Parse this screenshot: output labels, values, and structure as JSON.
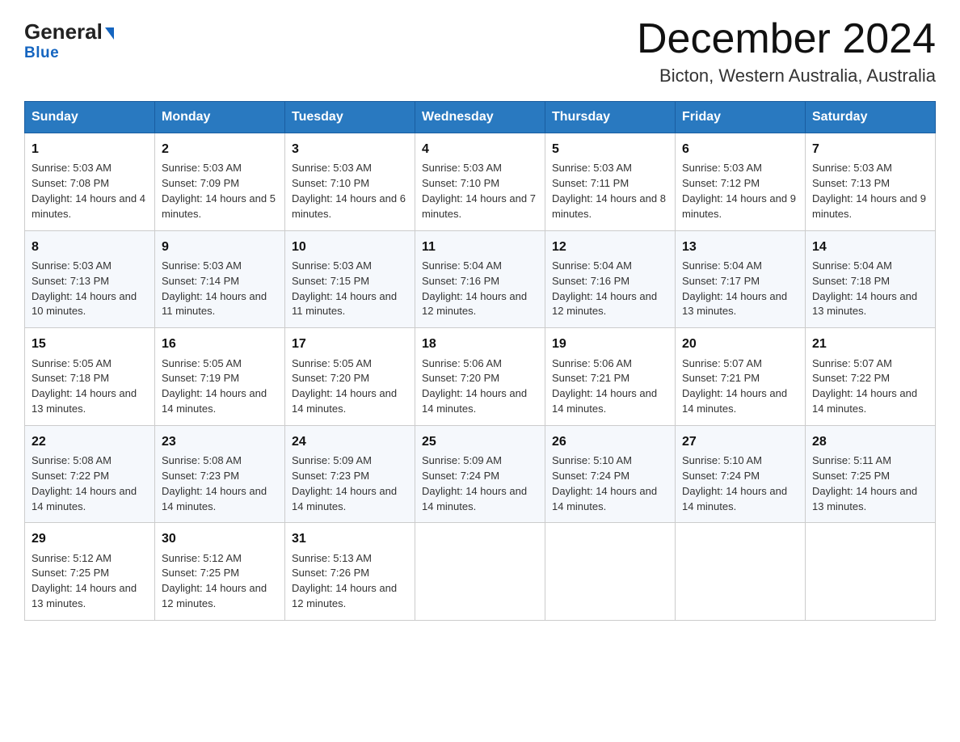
{
  "header": {
    "logo_general": "General",
    "logo_arrow": "▶",
    "logo_blue": "Blue",
    "month_title": "December 2024",
    "location": "Bicton, Western Australia, Australia"
  },
  "weekdays": [
    "Sunday",
    "Monday",
    "Tuesday",
    "Wednesday",
    "Thursday",
    "Friday",
    "Saturday"
  ],
  "weeks": [
    [
      {
        "day": "1",
        "sunrise": "5:03 AM",
        "sunset": "7:08 PM",
        "daylight": "14 hours and 4 minutes."
      },
      {
        "day": "2",
        "sunrise": "5:03 AM",
        "sunset": "7:09 PM",
        "daylight": "14 hours and 5 minutes."
      },
      {
        "day": "3",
        "sunrise": "5:03 AM",
        "sunset": "7:10 PM",
        "daylight": "14 hours and 6 minutes."
      },
      {
        "day": "4",
        "sunrise": "5:03 AM",
        "sunset": "7:10 PM",
        "daylight": "14 hours and 7 minutes."
      },
      {
        "day": "5",
        "sunrise": "5:03 AM",
        "sunset": "7:11 PM",
        "daylight": "14 hours and 8 minutes."
      },
      {
        "day": "6",
        "sunrise": "5:03 AM",
        "sunset": "7:12 PM",
        "daylight": "14 hours and 9 minutes."
      },
      {
        "day": "7",
        "sunrise": "5:03 AM",
        "sunset": "7:13 PM",
        "daylight": "14 hours and 9 minutes."
      }
    ],
    [
      {
        "day": "8",
        "sunrise": "5:03 AM",
        "sunset": "7:13 PM",
        "daylight": "14 hours and 10 minutes."
      },
      {
        "day": "9",
        "sunrise": "5:03 AM",
        "sunset": "7:14 PM",
        "daylight": "14 hours and 11 minutes."
      },
      {
        "day": "10",
        "sunrise": "5:03 AM",
        "sunset": "7:15 PM",
        "daylight": "14 hours and 11 minutes."
      },
      {
        "day": "11",
        "sunrise": "5:04 AM",
        "sunset": "7:16 PM",
        "daylight": "14 hours and 12 minutes."
      },
      {
        "day": "12",
        "sunrise": "5:04 AM",
        "sunset": "7:16 PM",
        "daylight": "14 hours and 12 minutes."
      },
      {
        "day": "13",
        "sunrise": "5:04 AM",
        "sunset": "7:17 PM",
        "daylight": "14 hours and 13 minutes."
      },
      {
        "day": "14",
        "sunrise": "5:04 AM",
        "sunset": "7:18 PM",
        "daylight": "14 hours and 13 minutes."
      }
    ],
    [
      {
        "day": "15",
        "sunrise": "5:05 AM",
        "sunset": "7:18 PM",
        "daylight": "14 hours and 13 minutes."
      },
      {
        "day": "16",
        "sunrise": "5:05 AM",
        "sunset": "7:19 PM",
        "daylight": "14 hours and 14 minutes."
      },
      {
        "day": "17",
        "sunrise": "5:05 AM",
        "sunset": "7:20 PM",
        "daylight": "14 hours and 14 minutes."
      },
      {
        "day": "18",
        "sunrise": "5:06 AM",
        "sunset": "7:20 PM",
        "daylight": "14 hours and 14 minutes."
      },
      {
        "day": "19",
        "sunrise": "5:06 AM",
        "sunset": "7:21 PM",
        "daylight": "14 hours and 14 minutes."
      },
      {
        "day": "20",
        "sunrise": "5:07 AM",
        "sunset": "7:21 PM",
        "daylight": "14 hours and 14 minutes."
      },
      {
        "day": "21",
        "sunrise": "5:07 AM",
        "sunset": "7:22 PM",
        "daylight": "14 hours and 14 minutes."
      }
    ],
    [
      {
        "day": "22",
        "sunrise": "5:08 AM",
        "sunset": "7:22 PM",
        "daylight": "14 hours and 14 minutes."
      },
      {
        "day": "23",
        "sunrise": "5:08 AM",
        "sunset": "7:23 PM",
        "daylight": "14 hours and 14 minutes."
      },
      {
        "day": "24",
        "sunrise": "5:09 AM",
        "sunset": "7:23 PM",
        "daylight": "14 hours and 14 minutes."
      },
      {
        "day": "25",
        "sunrise": "5:09 AM",
        "sunset": "7:24 PM",
        "daylight": "14 hours and 14 minutes."
      },
      {
        "day": "26",
        "sunrise": "5:10 AM",
        "sunset": "7:24 PM",
        "daylight": "14 hours and 14 minutes."
      },
      {
        "day": "27",
        "sunrise": "5:10 AM",
        "sunset": "7:24 PM",
        "daylight": "14 hours and 14 minutes."
      },
      {
        "day": "28",
        "sunrise": "5:11 AM",
        "sunset": "7:25 PM",
        "daylight": "14 hours and 13 minutes."
      }
    ],
    [
      {
        "day": "29",
        "sunrise": "5:12 AM",
        "sunset": "7:25 PM",
        "daylight": "14 hours and 13 minutes."
      },
      {
        "day": "30",
        "sunrise": "5:12 AM",
        "sunset": "7:25 PM",
        "daylight": "14 hours and 12 minutes."
      },
      {
        "day": "31",
        "sunrise": "5:13 AM",
        "sunset": "7:26 PM",
        "daylight": "14 hours and 12 minutes."
      },
      null,
      null,
      null,
      null
    ]
  ]
}
